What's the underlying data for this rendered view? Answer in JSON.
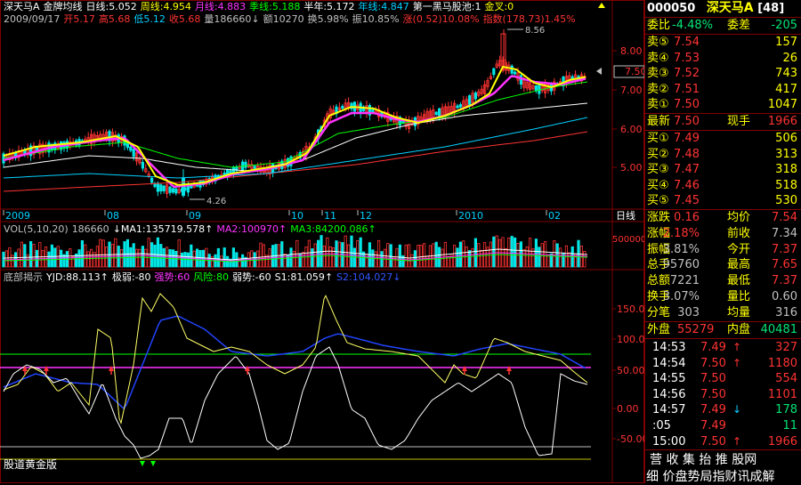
{
  "colors": {
    "up": "#ff3333",
    "down": "#00e676",
    "bg": "#000000",
    "border": "#800000",
    "yellow": "#ffff00",
    "magenta": "#ff33ff",
    "cyan": "#00d0ff",
    "white": "#ffffff"
  },
  "header": {
    "line1": [
      {
        "t": "深天马A",
        "c": "#ffffff"
      },
      {
        "t": "金牌均线",
        "c": "#ffffff"
      },
      {
        "t": "日线:5.052",
        "c": "#ffffff"
      },
      {
        "t": "周线:4.954",
        "c": "#ffff00"
      },
      {
        "t": "月线:4.883",
        "c": "#ff33ff"
      },
      {
        "t": "季线:5.188",
        "c": "#00ff00"
      },
      {
        "t": "半年:5.172",
        "c": "#ffffff"
      },
      {
        "t": "年线:4.847",
        "c": "#00d0ff"
      },
      {
        "t": "第一黑马股池:1",
        "c": "#ffffff"
      },
      {
        "t": "金叉:0",
        "c": "#ffff00"
      }
    ],
    "line2": [
      {
        "t": "2009/09/17",
        "c": "#c0c0c0"
      },
      {
        "t": "开5.17",
        "c": "#ff3333"
      },
      {
        "t": "高5.68",
        "c": "#ff3333"
      },
      {
        "t": "低5.12",
        "c": "#00d0ff"
      },
      {
        "t": "收5.68",
        "c": "#ff3333"
      },
      {
        "t": "量186660↓",
        "c": "#c0c0c0"
      },
      {
        "t": "额10270",
        "c": "#c0c0c0"
      },
      {
        "t": "换5.98%",
        "c": "#c0c0c0"
      },
      {
        "t": "振10.85%",
        "c": "#c0c0c0"
      },
      {
        "t": "涨(0.52)10.08%",
        "c": "#ff3333"
      },
      {
        "t": "指数(178.73)1.45%",
        "c": "#ff3333"
      }
    ],
    "vol_line": [
      {
        "t": "VOL(5,10,20)",
        "c": "#c0c0c0"
      },
      {
        "t": "186660",
        "c": "#c0c0c0"
      },
      {
        "t": "↓MA1:135719.578↑",
        "c": "#ffffff"
      },
      {
        "t": "MA2:100970↑",
        "c": "#ff33ff"
      },
      {
        "t": "MA3:84200.086↑",
        "c": "#00ff00"
      }
    ],
    "ind_line": [
      {
        "t": "底部揭示",
        "c": "#c0c0c0"
      },
      {
        "t": "YJD:88.113↑",
        "c": "#ffffff"
      },
      {
        "t": "极弱:-80",
        "c": "#ffffff"
      },
      {
        "t": "强势:60",
        "c": "#ff33ff"
      },
      {
        "t": "风险:80",
        "c": "#00ff00"
      },
      {
        "t": "弱势:-60",
        "c": "#ffffff"
      },
      {
        "t": "S1:81.059↑",
        "c": "#ffffff"
      },
      {
        "t": "S2:104.027↓",
        "c": "#3355ff"
      }
    ]
  },
  "price_axis": [
    "8.00",
    "7.00",
    "6.00",
    "5.00"
  ],
  "current_price_label": "7.50",
  "annotations": {
    "high": "8.56",
    "low": "4.26"
  },
  "date_axis": [
    "2009",
    "08",
    "09",
    "10",
    "11",
    "12",
    "2010",
    "02"
  ],
  "period_label": "日线",
  "vol_axis": [
    "500000"
  ],
  "ind_axis": [
    "150.00",
    "100.00",
    "50.00",
    "0.00",
    "-50.00"
  ],
  "watermark": "股道黄金版",
  "side": {
    "code": "000050",
    "name": "深天马A",
    "count": "[48]",
    "weibi_label": "委比",
    "weibi": "-4.48%",
    "weicha_label": "委差",
    "weicha": "-205",
    "sells": [
      {
        "label": "卖⑤",
        "price": "7.54",
        "vol": "157"
      },
      {
        "label": "卖④",
        "price": "7.53",
        "vol": "26"
      },
      {
        "label": "卖③",
        "price": "7.52",
        "vol": "743"
      },
      {
        "label": "卖②",
        "price": "7.51",
        "vol": "417"
      },
      {
        "label": "卖①",
        "price": "7.50",
        "vol": "1047"
      }
    ],
    "latest_label": "最新",
    "latest": "7.50",
    "xianshou_label": "现手",
    "xianshou": "1966",
    "buys": [
      {
        "label": "买①",
        "price": "7.49",
        "vol": "506"
      },
      {
        "label": "买②",
        "price": "7.48",
        "vol": "313"
      },
      {
        "label": "买③",
        "price": "7.47",
        "vol": "318"
      },
      {
        "label": "买④",
        "price": "7.46",
        "vol": "518"
      },
      {
        "label": "买⑤",
        "price": "7.45",
        "vol": "530"
      }
    ],
    "stats": [
      {
        "l1": "涨跌",
        "v1": "0.16",
        "c1": "#ff3333",
        "l2": "均价",
        "v2": "7.54",
        "c2": "#ff3333"
      },
      {
        "l1": "涨幅",
        "v1": "2.18%",
        "c1": "#ff3333",
        "l2": "前收",
        "v2": "7.34",
        "c2": "#c0c0c0"
      },
      {
        "l1": "振幅",
        "v1": "3.81%",
        "c1": "#c0c0c0",
        "l2": "今开",
        "v2": "7.37",
        "c2": "#ff3333"
      },
      {
        "l1": "总手",
        "v1": "95760",
        "c1": "#c0c0c0",
        "l2": "最高",
        "v2": "7.65",
        "c2": "#ff3333"
      },
      {
        "l1": "总额",
        "v1": "7221",
        "c1": "#c0c0c0",
        "l2": "最低",
        "v2": "7.37",
        "c2": "#ff3333"
      },
      {
        "l1": "换手",
        "v1": "3.07%",
        "c1": "#c0c0c0",
        "l2": "量比",
        "v2": "0.60",
        "c2": "#c0c0c0"
      },
      {
        "l1": "分笔",
        "v1": "303",
        "c1": "#c0c0c0",
        "l2": "均量",
        "v2": "316",
        "c2": "#c0c0c0"
      }
    ],
    "outer_label": "外盘",
    "outer": "55279",
    "inner_label": "内盘",
    "inner": "40481",
    "ticks": [
      {
        "time": "14:53",
        "price": "7.49",
        "arrow": "↑",
        "vol": "327",
        "pc": "#ff3333",
        "ac": "#ff3333",
        "vc": "#ff3333"
      },
      {
        "time": "14:54",
        "price": "7.50",
        "arrow": "↑",
        "vol": "1180",
        "pc": "#ff3333",
        "ac": "#ff3333",
        "vc": "#ff3333"
      },
      {
        "time": "14:55",
        "price": "7.50",
        "arrow": "",
        "vol": "554",
        "pc": "#ff3333",
        "ac": "#ff3333",
        "vc": "#ff3333"
      },
      {
        "time": "14:56",
        "price": "7.50",
        "arrow": "",
        "vol": "1101",
        "pc": "#ff3333",
        "ac": "#ff3333",
        "vc": "#ff3333"
      },
      {
        "time": "14:57",
        "price": "7.49",
        "arrow": "↓",
        "vol": "178",
        "pc": "#ff3333",
        "ac": "#00d0ff",
        "vc": "#00e676"
      },
      {
        "time": ":05",
        "price": "7.49",
        "arrow": "",
        "vol": "11",
        "pc": "#ff3333",
        "ac": "#ff3333",
        "vc": "#00e676"
      },
      {
        "time": "15:00",
        "price": "7.50",
        "arrow": "↑",
        "vol": "1966",
        "pc": "#ff3333",
        "ac": "#ff3333",
        "vc": "#ff3333"
      }
    ],
    "footer1": "营 收 集 抬 推 股网",
    "footer2": "细 价盘势局指财讯成解"
  }
}
